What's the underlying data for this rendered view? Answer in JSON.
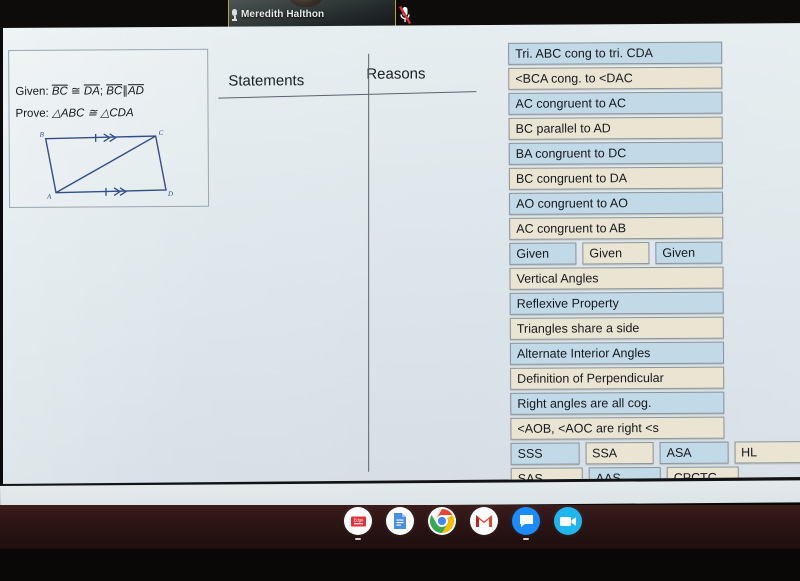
{
  "meeting": {
    "participant_name": "Meredith Halthon",
    "mic_icon": "microphone-icon",
    "muted_icon": "microphone-muted-icon"
  },
  "problem": {
    "given_label": "Given:",
    "given_part1": "BC",
    "given_cong1": "≅",
    "given_part2": "DA",
    "given_sep": ";",
    "given_part3": "BC",
    "given_parallel": "∥",
    "given_part4": "AD",
    "prove_label": "Prove:",
    "prove_text": "△ABC ≅ △CDA",
    "figure_vertices": [
      "B",
      "C",
      "A",
      "D"
    ]
  },
  "proof_table": {
    "statements_header": "Statements",
    "reasons_header": "Reasons"
  },
  "tiles": {
    "single": [
      {
        "label": "Tri. ABC cong to tri. CDA",
        "color": "blue"
      },
      {
        "label": "<BCA cong. to <DAC",
        "color": "cream"
      },
      {
        "label": "AC congruent to AC",
        "color": "blue"
      },
      {
        "label": "BC parallel to AD",
        "color": "cream"
      },
      {
        "label": "BA congruent to DC",
        "color": "blue"
      },
      {
        "label": "BC congruent to DA",
        "color": "cream"
      },
      {
        "label": "AO congruent to AO",
        "color": "blue"
      },
      {
        "label": "AC congruent to AB",
        "color": "cream"
      }
    ],
    "given_row": [
      {
        "label": "Given",
        "color": "blue"
      },
      {
        "label": "Given",
        "color": "cream"
      },
      {
        "label": "Given",
        "color": "blue"
      }
    ],
    "single2": [
      {
        "label": "Vertical Angles",
        "color": "cream"
      },
      {
        "label": "Reflexive Property",
        "color": "blue"
      },
      {
        "label": "Triangles share a side",
        "color": "cream"
      },
      {
        "label": "Alternate Interior Angles",
        "color": "blue"
      },
      {
        "label": "Definition of Perpendicular",
        "color": "cream"
      },
      {
        "label": "Right angles are all cog.",
        "color": "blue"
      },
      {
        "label": "<AOB, <AOC are right <s",
        "color": "cream"
      }
    ],
    "postulate_row1": [
      {
        "label": "SSS",
        "color": "blue"
      },
      {
        "label": "SSA",
        "color": "cream"
      },
      {
        "label": "ASA",
        "color": "blue"
      },
      {
        "label": "HL",
        "color": "cream"
      }
    ],
    "postulate_row2": [
      {
        "label": "SAS",
        "color": "cream"
      },
      {
        "label": "AAS",
        "color": "blue"
      },
      {
        "label": "CPCTC",
        "color": "cream"
      }
    ]
  },
  "shelf": {
    "apps": [
      {
        "name": "edgenuity-app-icon",
        "color": "#e23b3b"
      },
      {
        "name": "google-docs-icon",
        "color": "#3f8ce0"
      },
      {
        "name": "google-chrome-icon",
        "color": "#4285f4"
      },
      {
        "name": "gmail-icon",
        "color": "#ea4335"
      },
      {
        "name": "google-chat-icon",
        "color": "#1a8cff"
      },
      {
        "name": "google-meet-icon",
        "color": "#19b5f0"
      }
    ]
  },
  "colors": {
    "tile_blue": "#c2d9e8",
    "tile_cream": "#eae5d3",
    "surface": "#dfe8ec",
    "rule": "#59646b",
    "shelf": "#2b1414"
  }
}
